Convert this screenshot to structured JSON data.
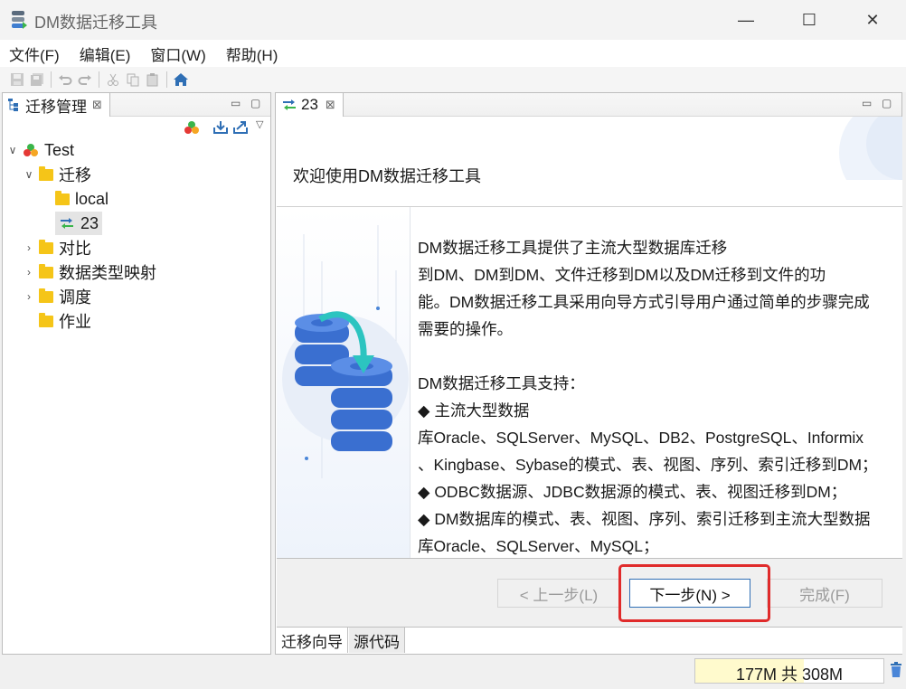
{
  "window": {
    "title": "DM数据迁移工具",
    "controls": {
      "minimize": "—",
      "maximize": "☐",
      "close": "✕"
    }
  },
  "menu": [
    "文件(F)",
    "编辑(E)",
    "窗口(W)",
    "帮助(H)"
  ],
  "toolbar": {
    "icons": [
      "save-icon",
      "save-all-icon",
      "undo-icon",
      "redo-icon",
      "cut-icon",
      "copy-icon",
      "paste-icon",
      "home-icon"
    ]
  },
  "left_view": {
    "tab_title": "迁移管理",
    "close_glyph": "⊠",
    "tree": [
      {
        "label": "Test",
        "level": 0,
        "expanded": true,
        "icon": "project-icon"
      },
      {
        "label": "迁移",
        "level": 1,
        "expanded": true,
        "icon": "folder-open-icon"
      },
      {
        "label": "local",
        "level": 2,
        "icon": "folder-open-icon"
      },
      {
        "label": "23",
        "level": 2,
        "icon": "migration-icon",
        "selected": true
      },
      {
        "label": "对比",
        "level": 1,
        "expanded": false,
        "icon": "folder-icon"
      },
      {
        "label": "数据类型映射",
        "level": 1,
        "expanded": false,
        "icon": "folder-icon"
      },
      {
        "label": "调度",
        "level": 1,
        "expanded": false,
        "icon": "folder-icon"
      },
      {
        "label": "作业",
        "level": 1,
        "icon": "folder-icon"
      }
    ]
  },
  "editor": {
    "tab_title": "23",
    "close_glyph": "⊠",
    "wizard": {
      "heading": "欢迎使用DM数据迁移工具",
      "lines": [
        "DM数据迁移工具提供了主流大型数据库迁移",
        "到DM、DM到DM、文件迁移到DM以及DM迁移到文件的功",
        "能。DM数据迁移工具采用向导方式引导用户通过简单的步骤完成",
        "需要的操作。",
        "",
        "DM数据迁移工具支持：",
        "◆ 主流大型数据",
        "库Oracle、SQLServer、MySQL、DB2、PostgreSQL、Informix",
        "、Kingbase、Sybase的模式、表、视图、序列、索引迁移到DM；",
        "◆ ODBC数据源、JDBC数据源的模式、表、视图迁移到DM；",
        "◆ DM数据库的模式、表、视图、序列、索引迁移到主流大型数据",
        "库Oracle、SQLServer、MySQL；"
      ],
      "buttons": {
        "back": "< 上一步(L)",
        "next": "下一步(N) >",
        "finish": "完成(F)"
      }
    },
    "bottom_tabs": [
      "迁移向导",
      "源代码"
    ]
  },
  "status": {
    "heap_text": "177M 共 308M",
    "heap_used_fraction": 0.575
  },
  "colors": {
    "accent": "#2f6fb5",
    "highlight": "#e02b2b",
    "folder": "#f5c518",
    "heap_fill": "#fffacd"
  }
}
